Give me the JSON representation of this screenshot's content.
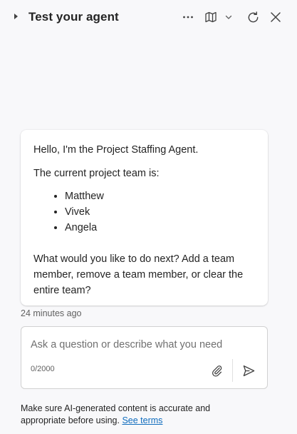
{
  "header": {
    "title": "Test your agent",
    "icons": [
      "chevron-right-icon",
      "more-icon",
      "map-icon",
      "chevron-down-icon",
      "refresh-icon",
      "close-icon"
    ]
  },
  "message": {
    "greeting": "Hello, I'm the Project Staffing Agent.",
    "team_intro": "The current project team is:",
    "team_members": [
      "Matthew",
      "Vivek",
      "Angela"
    ],
    "question": "What would you like to do next? Add a team member, remove a team member, or clear the entire team?",
    "timestamp": "24 minutes ago"
  },
  "composer": {
    "placeholder": "Ask a question or describe what you need",
    "value": "",
    "char_count": "0/2000",
    "icons": [
      "attach-icon",
      "send-icon"
    ]
  },
  "footer": {
    "disclaimer_text": "Make sure AI-generated content is accurate and appropriate before using.",
    "terms_link": "See terms"
  },
  "colors": {
    "background": "#f8f8fa",
    "link": "#0f6cbd",
    "text": "#242424"
  }
}
